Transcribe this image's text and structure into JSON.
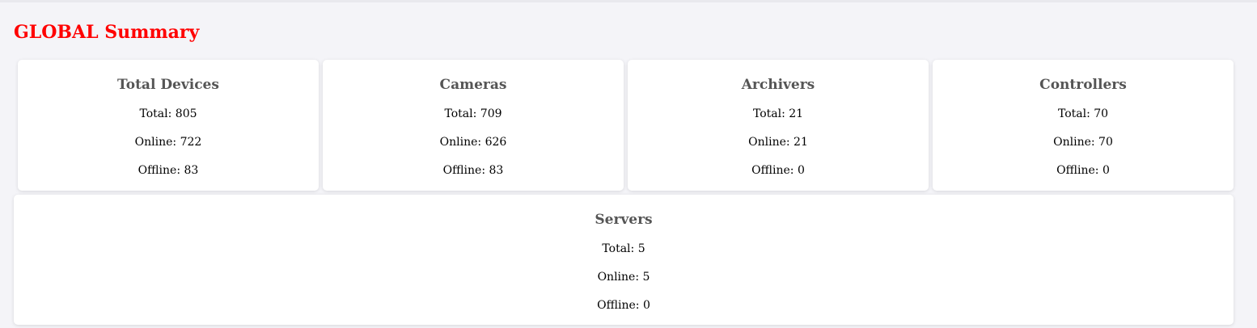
{
  "page": {
    "title": "GLOBAL Summary"
  },
  "colors": {
    "title": "#ff0000",
    "card_title": "#555555",
    "background": "#f4f4f8",
    "card_background": "#ffffff"
  },
  "cards": [
    {
      "title": "Total Devices",
      "total": "Total: 805",
      "online": "Online: 722",
      "offline": "Offline: 83"
    },
    {
      "title": "Cameras",
      "total": "Total: 709",
      "online": "Online: 626",
      "offline": "Offline: 83"
    },
    {
      "title": "Archivers",
      "total": "Total: 21",
      "online": "Online: 21",
      "offline": "Offline: 0"
    },
    {
      "title": "Controllers",
      "total": "Total: 70",
      "online": "Online: 70",
      "offline": "Offline: 0"
    },
    {
      "title": "Servers",
      "total": "Total: 5",
      "online": "Online: 5",
      "offline": "Offline: 0"
    }
  ]
}
